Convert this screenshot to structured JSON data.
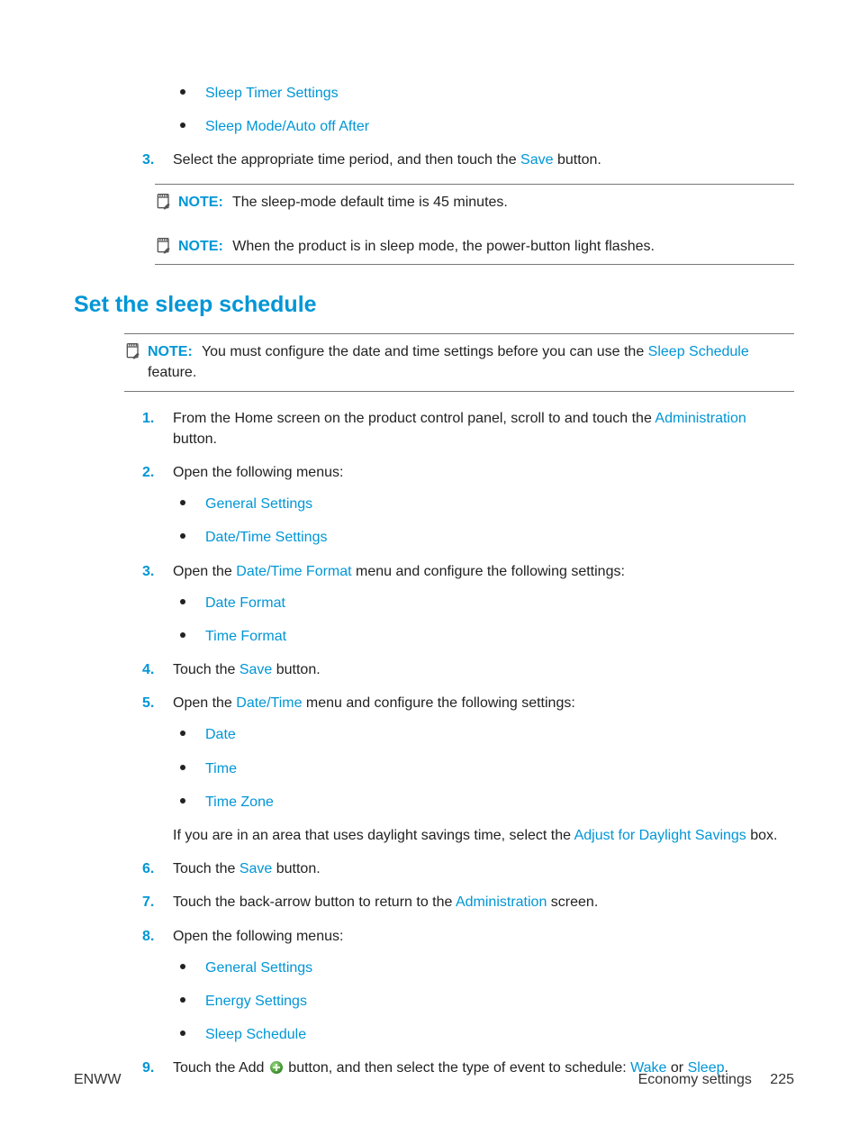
{
  "top_bullets": [
    "Sleep Timer Settings",
    "Sleep Mode/Auto off After"
  ],
  "step3": {
    "num": "3.",
    "pre": "Select the appropriate time period, and then touch the ",
    "link": "Save",
    "post": " button."
  },
  "note1": {
    "label": "NOTE:",
    "text": "The sleep-mode default time is 45 minutes."
  },
  "note2": {
    "label": "NOTE:",
    "text": "When the product is in sleep mode, the power-button light flashes."
  },
  "heading": "Set the sleep schedule",
  "note3": {
    "label": "NOTE:",
    "pre": "You must configure the date and time settings before you can use the ",
    "link": "Sleep Schedule",
    "post": " feature."
  },
  "steps": {
    "s1": {
      "num": "1.",
      "pre": "From the Home screen on the product control panel, scroll to and touch the ",
      "link": "Administration",
      "post": " button."
    },
    "s2": {
      "num": "2.",
      "text": "Open the following menus:",
      "bullets": [
        "General Settings",
        "Date/Time Settings"
      ]
    },
    "s3": {
      "num": "3.",
      "pre": "Open the ",
      "link": "Date/Time Format",
      "post": " menu and configure the following settings:",
      "bullets": [
        "Date Format",
        "Time Format"
      ]
    },
    "s4": {
      "num": "4.",
      "pre": "Touch the ",
      "link": "Save",
      "post": " button."
    },
    "s5": {
      "num": "5.",
      "pre": "Open the ",
      "link": "Date/Time",
      "post": " menu and configure the following settings:",
      "bullets": [
        "Date",
        "Time",
        "Time Zone"
      ],
      "extra_pre": "If you are in an area that uses daylight savings time, select the ",
      "extra_link": "Adjust for Daylight Savings",
      "extra_post": " box."
    },
    "s6": {
      "num": "6.",
      "pre": "Touch the ",
      "link": "Save",
      "post": " button."
    },
    "s7": {
      "num": "7.",
      "pre": "Touch the back-arrow button to return to the ",
      "link": "Administration",
      "post": " screen."
    },
    "s8": {
      "num": "8.",
      "text": "Open the following menus:",
      "bullets": [
        "General Settings",
        "Energy Settings",
        "Sleep Schedule"
      ]
    },
    "s9": {
      "num": "9.",
      "p1": "Touch the Add ",
      "p2": " button, and then select the type of event to schedule: ",
      "l1": "Wake",
      "mid": " or ",
      "l2": "Sleep",
      "end": "."
    }
  },
  "footer": {
    "left": "ENWW",
    "right": "Economy settings",
    "page": "225"
  }
}
